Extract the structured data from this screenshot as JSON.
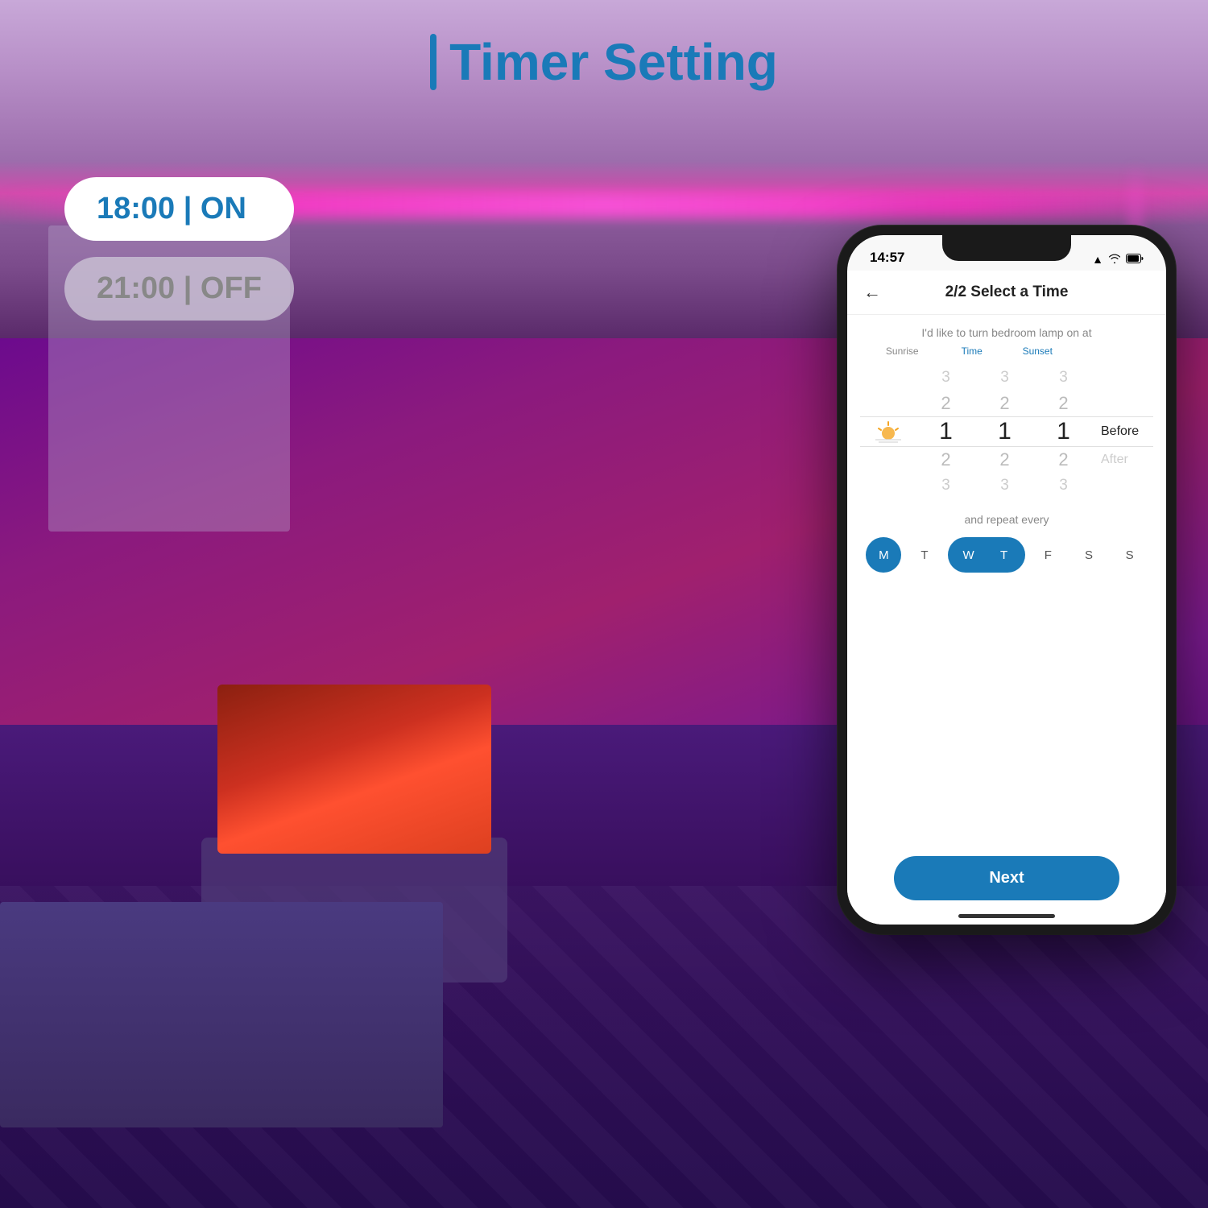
{
  "page": {
    "title": "Timer Setting",
    "title_bar_char": "|"
  },
  "timer_pills": {
    "on_pill": "18:00 | ON",
    "off_pill": "21:00 | OFF"
  },
  "phone": {
    "status_bar": {
      "time": "14:57",
      "signal_icon": "▲",
      "wifi_icon": "wifi",
      "battery_icon": "battery"
    },
    "header": {
      "back_label": "←",
      "title": "2/2 Select a Time"
    },
    "subtitle": "I'd like to turn bedroom lamp on at",
    "time_picker": {
      "sunrise_label": "Sunrise",
      "time_label": "Time",
      "sunset_label": "Sunset",
      "sunrise_icon": "🌅",
      "col1_values": [
        "3",
        "2",
        "1",
        "2",
        "3"
      ],
      "col1_selected_index": 2,
      "col2_values": [
        "3",
        "2",
        "1",
        "2",
        "3"
      ],
      "col2_selected_index": 2,
      "col3_values": [
        "3",
        "2",
        "1",
        "2",
        "3"
      ],
      "col3_selected_index": 2,
      "before_after": [
        "Before",
        "After"
      ],
      "selected_option": "Before"
    },
    "repeat_section": {
      "label": "and repeat every",
      "days": [
        {
          "label": "M",
          "active": true
        },
        {
          "label": "T",
          "active": false
        },
        {
          "label": "W",
          "active": true
        },
        {
          "label": "T",
          "active": true
        },
        {
          "label": "F",
          "active": false
        },
        {
          "label": "S",
          "active": false
        },
        {
          "label": "S",
          "active": false
        }
      ]
    },
    "next_button": {
      "label": "Next"
    }
  },
  "colors": {
    "brand_blue": "#1a7ab8",
    "pill_on_bg": "#ffffff",
    "pill_on_text": "#1a7ab8",
    "pill_off_bg": "#c8c0d0",
    "pill_off_text": "#888888"
  }
}
